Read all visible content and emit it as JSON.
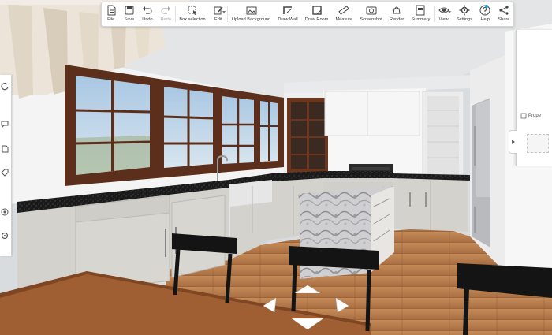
{
  "app": {
    "toolbar": [
      {
        "label": "File",
        "icon": "file-icon",
        "name": "file-button",
        "enabled": true,
        "caret": false
      },
      {
        "label": "Save",
        "icon": "save-icon",
        "name": "save-button",
        "enabled": true,
        "caret": false
      },
      {
        "label": "Undo",
        "icon": "undo-icon",
        "name": "undo-button",
        "enabled": true,
        "caret": false
      },
      {
        "label": "Redo",
        "icon": "redo-icon",
        "name": "redo-button",
        "enabled": false,
        "caret": false
      },
      {
        "label": "Box selection",
        "icon": "box-selection-icon",
        "name": "box-selection-button",
        "enabled": true,
        "caret": false
      },
      {
        "label": "Edit",
        "icon": "edit-icon",
        "name": "edit-button",
        "enabled": true,
        "caret": true
      },
      {
        "label": "Upload Background",
        "icon": "upload-background-icon",
        "name": "upload-background-button",
        "enabled": true,
        "caret": false
      },
      {
        "label": "Draw Wall",
        "icon": "draw-wall-icon",
        "name": "draw-wall-button",
        "enabled": true,
        "caret": false
      },
      {
        "label": "Draw Room",
        "icon": "draw-room-icon",
        "name": "draw-room-button",
        "enabled": true,
        "caret": false
      },
      {
        "label": "Measure",
        "icon": "measure-icon",
        "name": "measure-button",
        "enabled": true,
        "caret": false
      },
      {
        "label": "Screenshot",
        "icon": "screenshot-icon",
        "name": "screenshot-button",
        "enabled": true,
        "caret": false
      },
      {
        "label": "Render",
        "icon": "render-icon",
        "name": "render-button",
        "enabled": true,
        "caret": false
      },
      {
        "label": "Summary",
        "icon": "summary-icon",
        "name": "summary-button",
        "enabled": true,
        "caret": false
      },
      {
        "label": "View",
        "icon": "view-icon",
        "name": "view-button",
        "enabled": true,
        "caret": true
      },
      {
        "label": "Settings",
        "icon": "settings-icon",
        "name": "settings-button",
        "enabled": true,
        "caret": false
      },
      {
        "label": "Help",
        "icon": "help-icon",
        "name": "help-button",
        "enabled": true,
        "caret": false
      },
      {
        "label": "Share",
        "icon": "share-icon",
        "name": "share-button",
        "enabled": true,
        "caret": false
      }
    ],
    "right_panel": {
      "properties_label": "Prope"
    },
    "left_rail": {
      "tools": [
        "rotate-icon",
        "comment-icon",
        "document-icon",
        "tag-icon",
        "target-icon",
        "settings-icon"
      ]
    },
    "colors": {
      "accent": "#1fa4d8",
      "countertop": "#1b1b1b",
      "cabinet": "#d4d2cc",
      "floor": "#b37a4f",
      "window_frame": "#5b2f1b",
      "wall": "#f3f3f3"
    }
  }
}
